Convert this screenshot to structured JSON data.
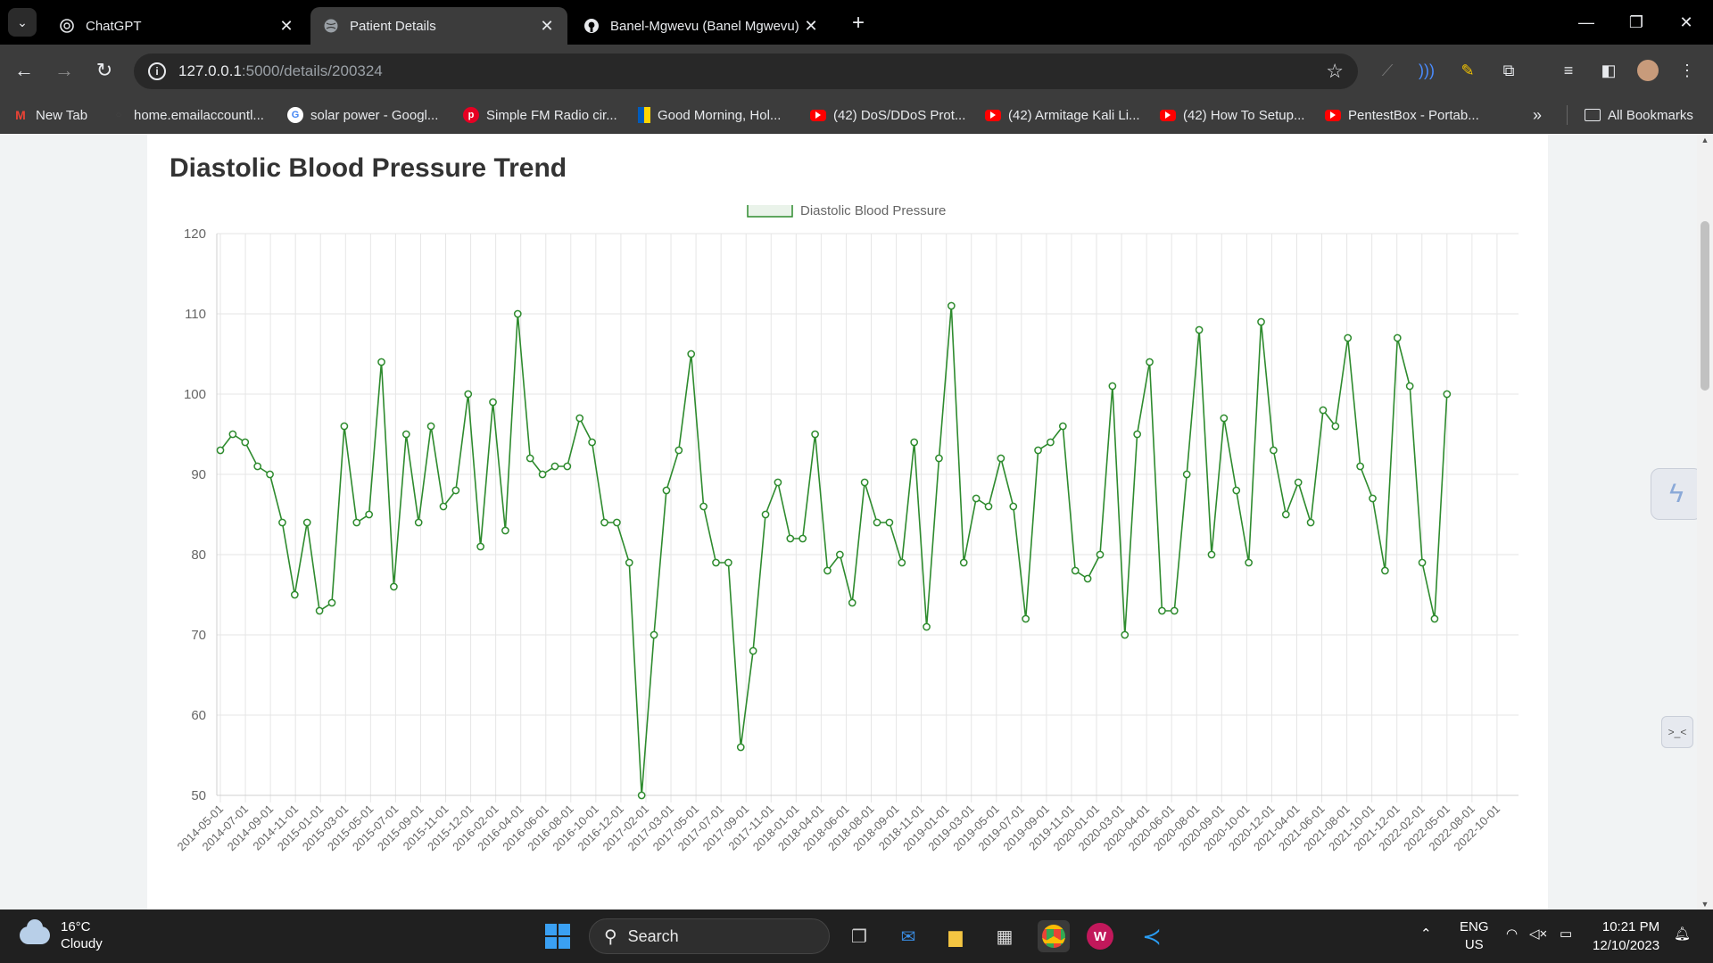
{
  "tabs": [
    {
      "title": "ChatGPT",
      "active": false,
      "icon": "chatgpt-icon"
    },
    {
      "title": "Patient Details",
      "active": true,
      "icon": "globe-icon"
    },
    {
      "title": "Banel-Mgwevu (Banel Mgwevu)",
      "active": false,
      "icon": "github-icon"
    }
  ],
  "address_bar": {
    "host": "127.0.0.1",
    "path": ":5000/details/200324"
  },
  "bookmarks": [
    {
      "label": "New Tab",
      "icon": "gmail-icon"
    },
    {
      "label": "home.emailaccountl...",
      "icon": "outlook-icon"
    },
    {
      "label": "solar power - Googl...",
      "icon": "google-icon"
    },
    {
      "label": "Simple FM Radio cir...",
      "icon": "pinterest-icon"
    },
    {
      "label": "Good Morning, Hol...",
      "icon": "bookmark-icon"
    },
    {
      "label": "(42) DoS/DDoS Prot...",
      "icon": "youtube-icon"
    },
    {
      "label": "(42) Armitage Kali Li...",
      "icon": "youtube-icon"
    },
    {
      "label": "(42) How To Setup...",
      "icon": "youtube-icon"
    },
    {
      "label": "PentestBox - Portab...",
      "icon": "youtube-icon"
    }
  ],
  "all_bookmarks_label": "All Bookmarks",
  "page": {
    "title": "Diastolic Blood Pressure Trend"
  },
  "chart_data": {
    "type": "line",
    "title": "",
    "xlabel": "",
    "ylabel": "",
    "ylim": [
      50,
      120
    ],
    "yticks": [
      50,
      60,
      70,
      80,
      90,
      100,
      110,
      120
    ],
    "grid": true,
    "legend_position": "top-center",
    "line_color": "#2e8b2e",
    "x_tick_labels": [
      "2014-05-01",
      "2014-07-01",
      "2014-09-01",
      "2014-11-01",
      "2015-01-01",
      "2015-03-01",
      "2015-05-01",
      "2015-07-01",
      "2015-09-01",
      "2015-11-01",
      "2015-12-01",
      "2016-02-01",
      "2016-04-01",
      "2016-06-01",
      "2016-08-01",
      "2016-10-01",
      "2016-12-01",
      "2017-02-01",
      "2017-03-01",
      "2017-05-01",
      "2017-07-01",
      "2017-09-01",
      "2017-11-01",
      "2018-01-01",
      "2018-04-01",
      "2018-06-01",
      "2018-08-01",
      "2018-09-01",
      "2018-11-01",
      "2019-01-01",
      "2019-03-01",
      "2019-05-01",
      "2019-07-01",
      "2019-09-01",
      "2019-11-01",
      "2020-01-01",
      "2020-03-01",
      "2020-04-01",
      "2020-06-01",
      "2020-08-01",
      "2020-09-01",
      "2020-10-01",
      "2020-12-01",
      "2021-04-01",
      "2021-06-01",
      "2021-08-01",
      "2021-10-01",
      "2021-12-01",
      "2022-02-01",
      "2022-05-01",
      "2022-08-01",
      "2022-10-01"
    ],
    "series": [
      {
        "name": "Diastolic Blood Pressure",
        "values": [
          93,
          95,
          94,
          91,
          90,
          84,
          75,
          84,
          73,
          74,
          96,
          84,
          85,
          104,
          76,
          95,
          84,
          96,
          86,
          88,
          100,
          81,
          99,
          83,
          110,
          92,
          90,
          91,
          91,
          97,
          94,
          84,
          84,
          79,
          50,
          70,
          88,
          93,
          105,
          86,
          79,
          79,
          56,
          68,
          85,
          89,
          82,
          82,
          95,
          78,
          80,
          74,
          89,
          84,
          84,
          79,
          94,
          71,
          92,
          111,
          79,
          87,
          86,
          92,
          86,
          72,
          93,
          94,
          96,
          78,
          77,
          80,
          101,
          70,
          95,
          104,
          73,
          73,
          90,
          108,
          80,
          97,
          88,
          79,
          109,
          93,
          85,
          89,
          84,
          98,
          96,
          107,
          91,
          87,
          78,
          107,
          101,
          79,
          72,
          100
        ]
      }
    ]
  },
  "taskbar": {
    "weather_temp": "16°C",
    "weather_desc": "Cloudy",
    "search_label": "Search",
    "lang": "ENG",
    "region": "US",
    "time": "10:21 PM",
    "date": "12/10/2023"
  }
}
